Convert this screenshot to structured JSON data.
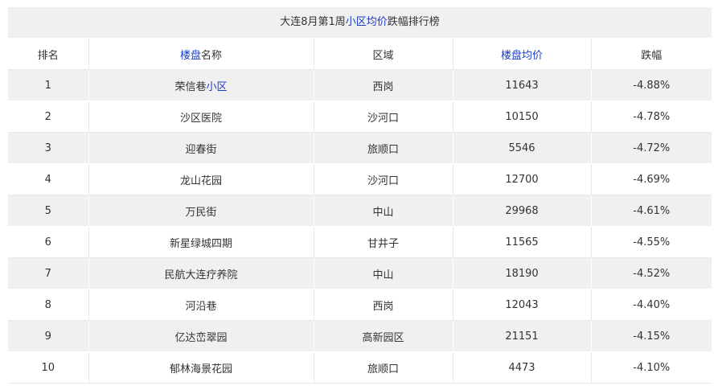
{
  "table": {
    "title_prefix": "大连8月第1周",
    "title_link": "小区均价",
    "title_suffix": "跌幅排行榜",
    "headers": {
      "rank": "排名",
      "name_link": "楼盘",
      "name_rest": "名称",
      "district": "区域",
      "price": "楼盘均价",
      "change": "跌幅"
    },
    "rows": [
      {
        "rank": "1",
        "name": "荣信巷",
        "name_link": "小区",
        "district": "西岗",
        "price": "11643",
        "change": "-4.88%"
      },
      {
        "rank": "2",
        "name": "沙区医院",
        "name_link": "",
        "district": "沙河口",
        "price": "10150",
        "change": "-4.78%"
      },
      {
        "rank": "3",
        "name": "迎春街",
        "name_link": "",
        "district": "旅顺口",
        "price": "5546",
        "change": "-4.72%"
      },
      {
        "rank": "4",
        "name": "龙山花园",
        "name_link": "",
        "district": "沙河口",
        "price": "12700",
        "change": "-4.69%"
      },
      {
        "rank": "5",
        "name": "万民街",
        "name_link": "",
        "district": "中山",
        "price": "29968",
        "change": "-4.61%"
      },
      {
        "rank": "6",
        "name": "新星绿城四期",
        "name_link": "",
        "district": "甘井子",
        "price": "11565",
        "change": "-4.55%"
      },
      {
        "rank": "7",
        "name": "民航大连疗养院",
        "name_link": "",
        "district": "中山",
        "price": "18190",
        "change": "-4.52%"
      },
      {
        "rank": "8",
        "name": "河沿巷",
        "name_link": "",
        "district": "西岗",
        "price": "12043",
        "change": "-4.40%"
      },
      {
        "rank": "9",
        "name": "亿达峦翠园",
        "name_link": "",
        "district": "高新园区",
        "price": "21151",
        "change": "-4.15%"
      },
      {
        "rank": "10",
        "name": "郁林海景花园",
        "name_link": "",
        "district": "旅顺口",
        "price": "4473",
        "change": "-4.10%"
      }
    ]
  },
  "colors": {
    "link": "#1a3cc8",
    "stripe": "#f0f0f0",
    "text": "#333333"
  }
}
